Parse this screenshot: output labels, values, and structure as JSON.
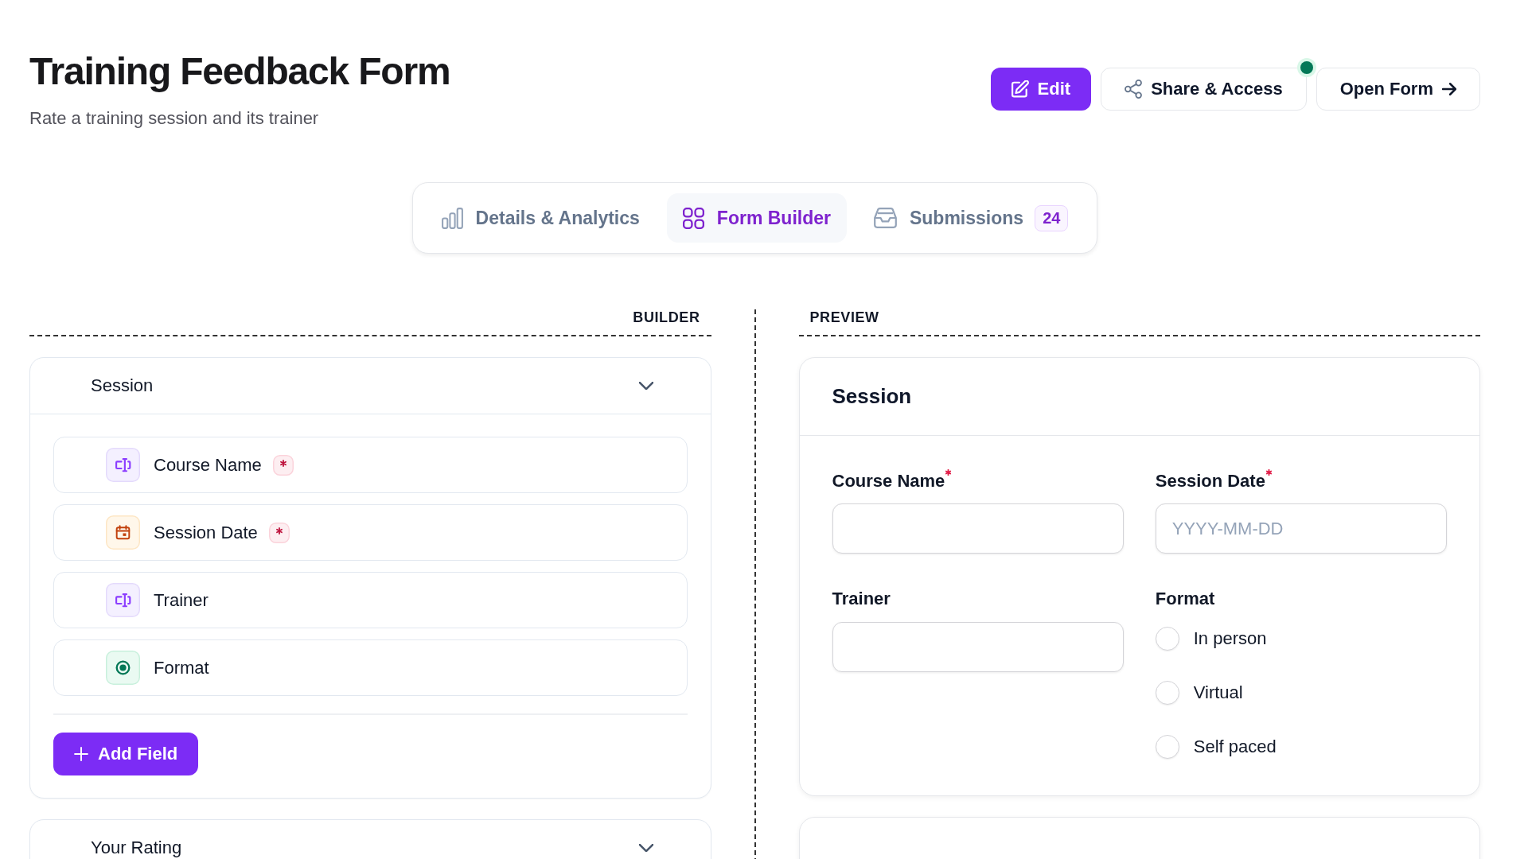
{
  "header": {
    "title": "Training Feedback Form",
    "subtitle": "Rate a training session and its trainer",
    "actions": [
      {
        "label": "Edit",
        "kind": "primary",
        "indicator": false
      },
      {
        "label": "Share & Access",
        "kind": "secondary",
        "indicator": true
      },
      {
        "label": "Open Form",
        "kind": "secondary",
        "indicator": false
      }
    ]
  },
  "tabs": [
    {
      "label": "Details & Analytics",
      "selected": false
    },
    {
      "label": "Form Builder",
      "selected": true
    },
    {
      "label": "Submissions",
      "selected": false,
      "badge": "24"
    }
  ],
  "builder": {
    "heading": "BUILDER",
    "sections": [
      {
        "title": "Session",
        "expanded": true,
        "fields": [
          {
            "label": "Course Name",
            "kind": "text",
            "required": true
          },
          {
            "label": "Session Date",
            "kind": "date",
            "required": true
          },
          {
            "label": "Trainer",
            "kind": "text",
            "required": false
          },
          {
            "label": "Format",
            "kind": "radio",
            "required": false
          }
        ],
        "add_button": "Add Field"
      },
      {
        "title": "Your Rating",
        "expanded": true
      }
    ]
  },
  "preview": {
    "heading": "PREVIEW",
    "sections": [
      {
        "title": "Session",
        "fields": [
          {
            "label": "Course Name",
            "kind": "text",
            "required": true
          },
          {
            "label": "Session Date",
            "kind": "date",
            "required": true,
            "placeholder": "YYYY-MM-DD"
          },
          {
            "label": "Trainer",
            "kind": "text",
            "required": false
          },
          {
            "label": "Format",
            "kind": "radio",
            "required": false,
            "options": [
              {
                "label": "In person",
                "selected": false
              },
              {
                "label": "Virtual",
                "selected": false
              },
              {
                "label": "Self paced",
                "selected": false
              }
            ]
          }
        ]
      }
    ]
  }
}
